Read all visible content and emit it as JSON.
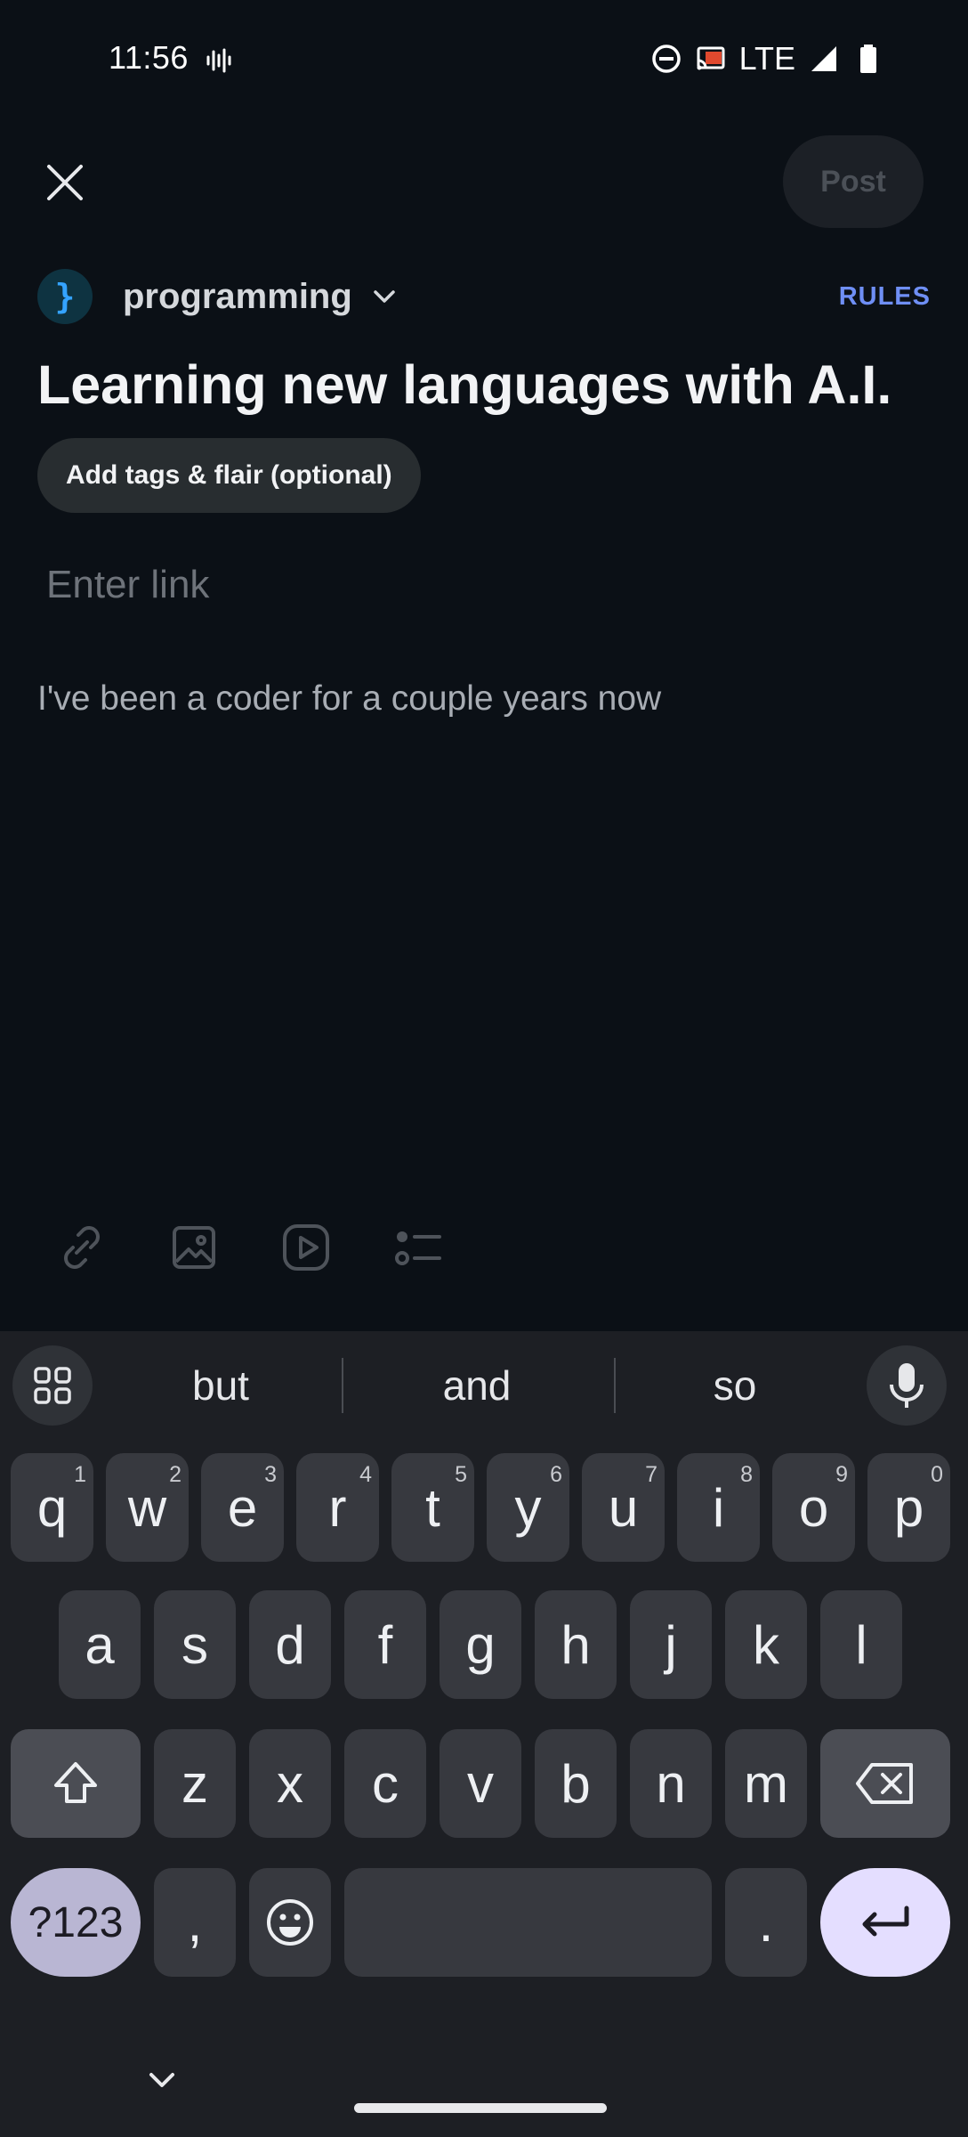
{
  "status_bar": {
    "time": "11:56",
    "network": "LTE",
    "icons": [
      "voice-activity-icon",
      "dnd-icon",
      "cast-icon",
      "signal-icon",
      "battery-icon"
    ]
  },
  "header": {
    "close_icon": "close-icon",
    "post_label": "Post"
  },
  "community": {
    "avatar_glyph": "}",
    "name": "programming",
    "rules_label": "RULES"
  },
  "post": {
    "title": "Learning new languages with A.I.",
    "tags_label": "Add tags & flair (optional)",
    "link_placeholder": "Enter link",
    "body": "I've been a coder for a couple years now"
  },
  "format_toolbar": [
    "link-icon",
    "image-icon",
    "video-icon",
    "poll-icon"
  ],
  "keyboard": {
    "suggestions": [
      "but",
      "and",
      "so"
    ],
    "row1": [
      {
        "key": "q",
        "digit": "1"
      },
      {
        "key": "w",
        "digit": "2"
      },
      {
        "key": "e",
        "digit": "3"
      },
      {
        "key": "r",
        "digit": "4"
      },
      {
        "key": "t",
        "digit": "5"
      },
      {
        "key": "y",
        "digit": "6"
      },
      {
        "key": "u",
        "digit": "7"
      },
      {
        "key": "i",
        "digit": "8"
      },
      {
        "key": "o",
        "digit": "9"
      },
      {
        "key": "p",
        "digit": "0"
      }
    ],
    "row2": [
      "a",
      "s",
      "d",
      "f",
      "g",
      "h",
      "j",
      "k",
      "l"
    ],
    "row3": [
      "z",
      "x",
      "c",
      "v",
      "b",
      "n",
      "m"
    ],
    "symbols_label": "?123",
    "comma": ",",
    "period": "."
  },
  "colors": {
    "background": "#0b1016",
    "accent_rules": "#6f8ff5",
    "keyboard_bg": "#1d1f24",
    "enter_key": "#e4deff"
  }
}
